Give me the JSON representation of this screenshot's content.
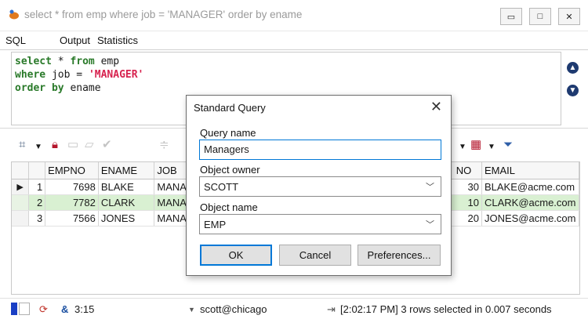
{
  "window": {
    "title": "select * from emp where job = 'MANAGER' order by ename",
    "minimize": "▭",
    "maximize": "□",
    "close": "✕"
  },
  "tabs": [
    "SQL",
    "Output",
    "Statistics"
  ],
  "editor": {
    "line1_kw1": "select",
    "line1_rest1": " * ",
    "line1_kw2": "from",
    "line1_rest2": " emp",
    "line2_kw": "where",
    "line2_rest": " job = ",
    "line2_str": "'MANAGER'",
    "line3_kw": "order by",
    "line3_rest": " ename"
  },
  "grid": {
    "columns": [
      "EMPNO",
      "ENAME",
      "JOB",
      "NO",
      "EMAIL"
    ],
    "rows": [
      {
        "num": "1",
        "empno": "7698",
        "ename": "BLAKE",
        "job": "MANA",
        "deptno": "30",
        "email": "BLAKE@acme.com"
      },
      {
        "num": "2",
        "empno": "7782",
        "ename": "CLARK",
        "job": "MANA",
        "deptno": "10",
        "email": "CLARK@acme.com"
      },
      {
        "num": "3",
        "empno": "7566",
        "ename": "JONES",
        "job": "MANA",
        "deptno": "20",
        "email": "JONES@acme.com"
      }
    ]
  },
  "status": {
    "cursor_pos": "3:15",
    "connection": "scott@chicago",
    "message": "[2:02:17 PM]  3 rows selected in 0.007 seconds"
  },
  "dialog": {
    "title": "Standard Query",
    "close": "✕",
    "query_name_label": "Query name",
    "query_name_value": "Managers",
    "owner_label": "Object owner",
    "owner_value": "SCOTT",
    "object_label": "Object name",
    "object_value": "EMP",
    "ok": "OK",
    "cancel": "Cancel",
    "preferences": "Preferences..."
  },
  "colors": {
    "selected_row": "#d9f0d2",
    "keyword": "#2a7a2a",
    "string": "#d7234f",
    "focus": "#0078d7"
  }
}
